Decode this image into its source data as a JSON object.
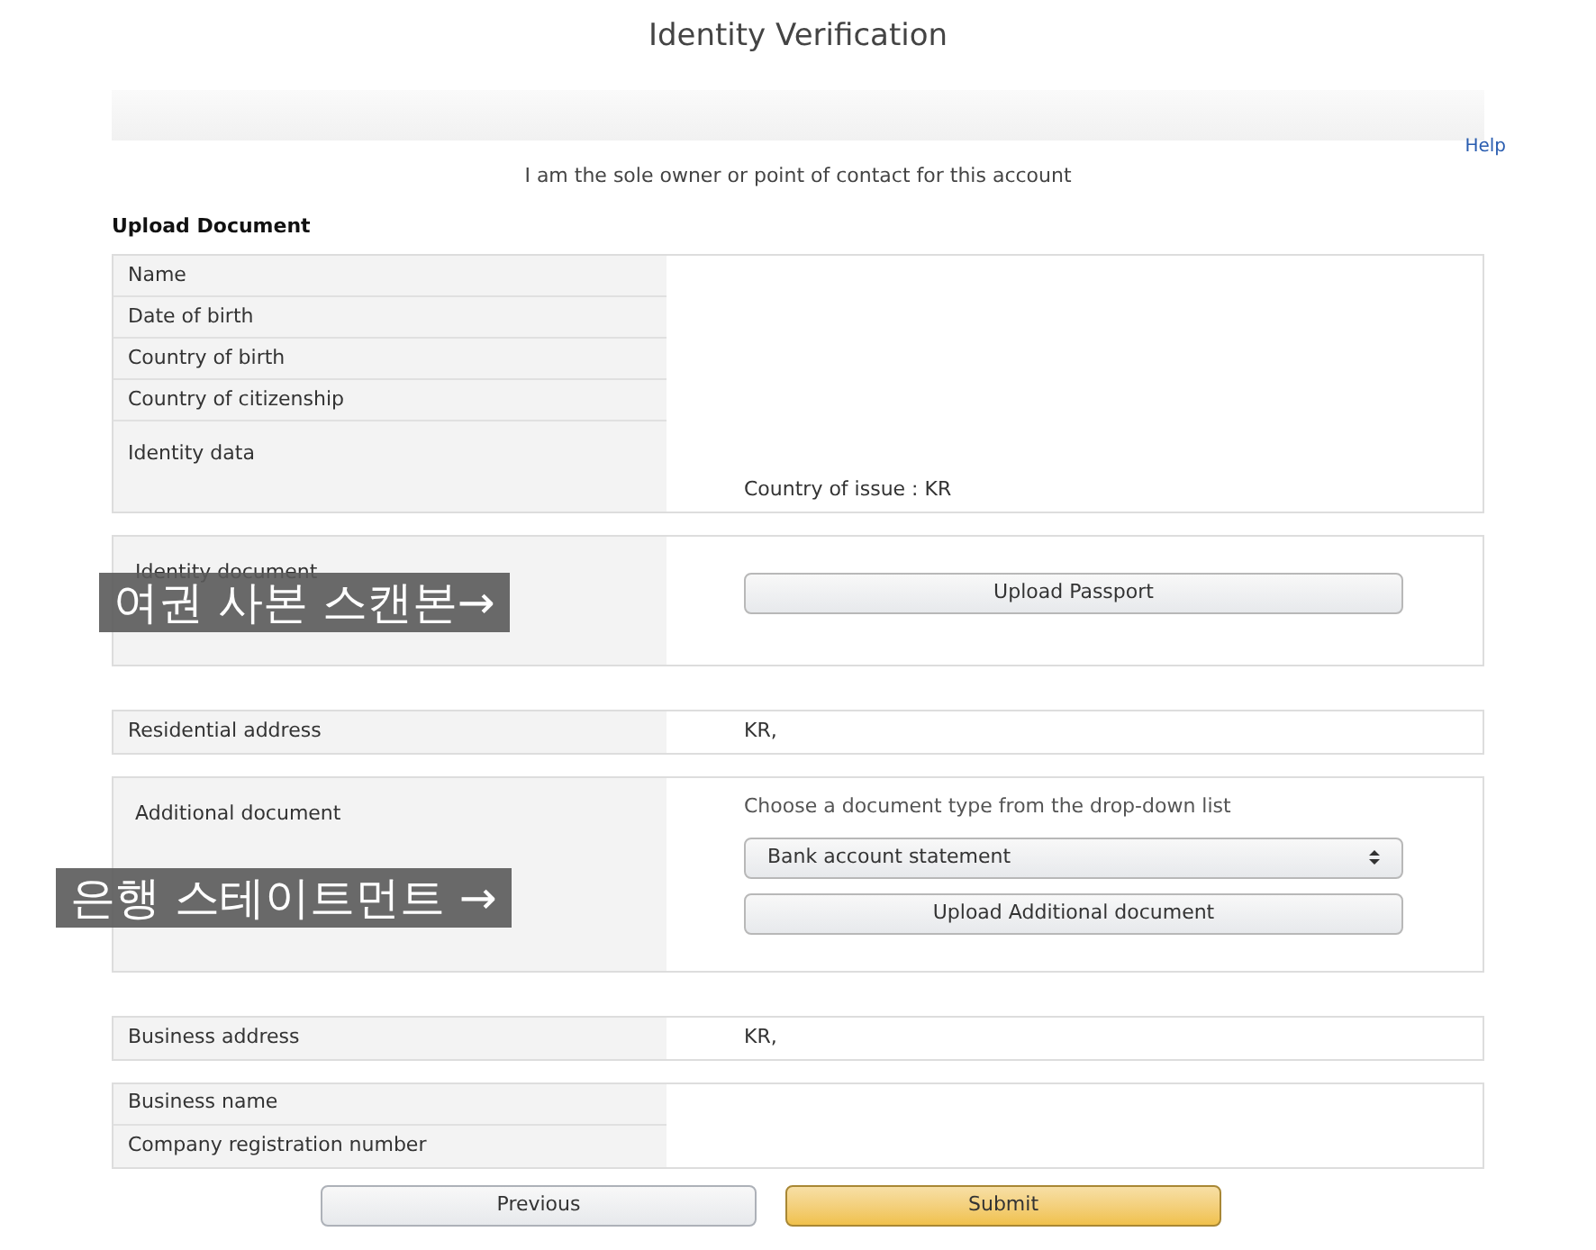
{
  "title": "Identity Verification",
  "help": "Help",
  "statement": "I am the sole owner or point of contact for this account",
  "section_heading": "Upload Document",
  "sections": [
    {
      "rows": [
        {
          "label": "Name"
        },
        {
          "label": "Date of birth"
        },
        {
          "label": "Country of birth"
        },
        {
          "label": "Country of citizenship"
        },
        {
          "label": "Identity data",
          "value": "Country of issue : KR",
          "kind": "tall"
        }
      ]
    },
    {
      "rows": [
        {
          "label": "Identity document",
          "kind": "upload",
          "button": "Upload Passport",
          "annotation": "여권 사본 스캔본→"
        }
      ]
    },
    {
      "rows": [
        {
          "label": "Residential address",
          "value": "KR,"
        }
      ]
    },
    {
      "rows": [
        {
          "label": "Additional document",
          "kind": "upload",
          "hint": "Choose a document type from the drop-down list",
          "select": "Bank account statement",
          "button": "Upload Additional document",
          "annotation": "은행 스테이트먼트 →"
        }
      ]
    },
    {
      "rows": [
        {
          "label": "Business address",
          "value": "KR,"
        }
      ]
    },
    {
      "rows": [
        {
          "label": "Business name"
        },
        {
          "label": "Company registration number"
        }
      ]
    }
  ],
  "buttons": [
    {
      "label": "Previous",
      "kind": "secondary"
    },
    {
      "label": "Submit",
      "kind": "primary"
    }
  ]
}
